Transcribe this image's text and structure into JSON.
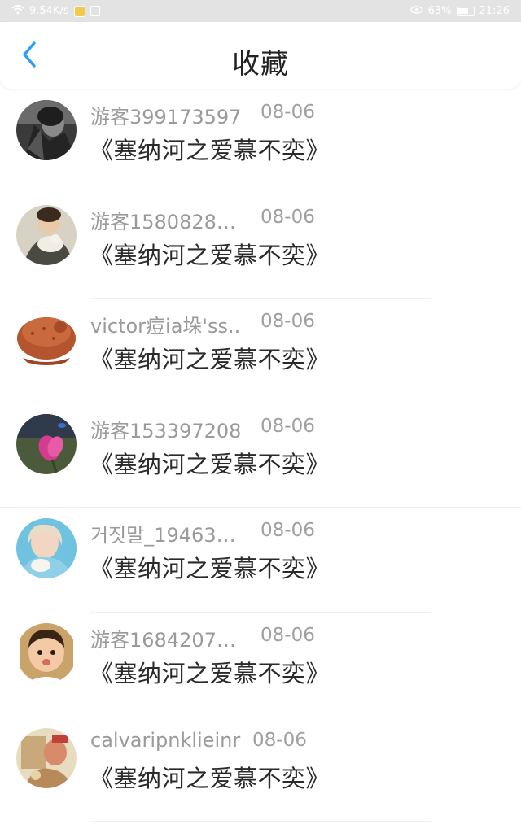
{
  "statusbar": {
    "speed": "9.54K/s",
    "battery": "63%",
    "time": "21:26"
  },
  "header": {
    "title": "收藏",
    "back_icon": "chevron-left-icon",
    "accent": "#2b9ff0"
  },
  "items": [
    {
      "user": "游客399173597",
      "date": "08-06",
      "book": "《塞纳河之爱慕不奕》"
    },
    {
      "user": "游客1580828…",
      "date": "08-06",
      "book": "《塞纳河之爱慕不奕》"
    },
    {
      "user": "victor痘ia垛'ss..",
      "date": "08-06",
      "book": "《塞纳河之爱慕不奕》"
    },
    {
      "user": "游客153397208",
      "date": "08-06",
      "book": "《塞纳河之爱慕不奕》"
    },
    {
      "user": "거짓말_19463…",
      "date": "08-06",
      "book": "《塞纳河之爱慕不奕》"
    },
    {
      "user": "游客1684207…",
      "date": "08-06",
      "book": "《塞纳河之爱慕不奕》"
    },
    {
      "user": "calvaripnklieinr",
      "date": "08-06",
      "book": "《塞纳河之爱慕不奕》"
    }
  ]
}
